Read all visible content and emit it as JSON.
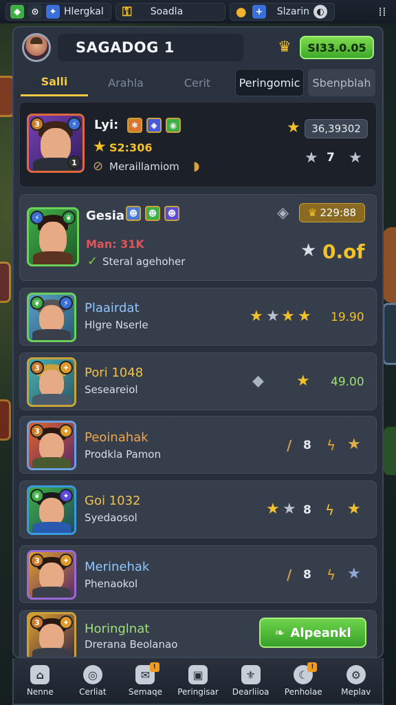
{
  "topbar": {
    "chips": [
      {
        "icon": "gem-icon",
        "label": "Hlergkal"
      },
      {
        "icon": "key-icon",
        "label": "Soadla"
      },
      {
        "icon": "plus-icon",
        "label": "Slzarin"
      }
    ],
    "menu_icon": "dots-grid-icon"
  },
  "header": {
    "title": "SAGADOG 1",
    "cash_value": "SI33.0.05"
  },
  "tabs": [
    "Salli",
    "Arahla",
    "Cerit",
    "Peringomic",
    "Sbenpblah"
  ],
  "featured": {
    "name": "Lyi:",
    "stat": "S2:306",
    "meta": "Meraillamiom",
    "value": "36,39302",
    "count": "7"
  },
  "second": {
    "name": "Gesia",
    "main": "Man: 31K",
    "desc": "Steral agehoher",
    "value": "229:88",
    "rating": "0.of"
  },
  "rows": [
    {
      "name": "Plaairdat",
      "sub": "Hlgre Nserle",
      "value": "19.90",
      "name_color": "#8fc6ff"
    },
    {
      "name": "Pori 1048",
      "sub": "Seseareiol",
      "value": "49.00",
      "name_color": "#f1c24a"
    },
    {
      "name": "Peoinahak",
      "sub": "Prodkla Pamon",
      "value": "",
      "name_color": "#f3a54a"
    },
    {
      "name": "Goi 1032",
      "sub": "Syedaosol",
      "value": "8",
      "name_color": "#f1c24a"
    },
    {
      "name": "Merinehak",
      "sub": "Phenaokol",
      "value": "8",
      "name_color": "#8fc6ff"
    },
    {
      "name": "Horinglnat",
      "sub": "Drerana Beolanao",
      "value": "",
      "name_color": "#9fe07a"
    }
  ],
  "row3_count": "8",
  "row_action": "Alpeankl",
  "nav": [
    "Nenne",
    "Cerliat",
    "Semaqe",
    "Peringisar",
    "Dearliioa",
    "Penholae",
    "Meplav"
  ]
}
